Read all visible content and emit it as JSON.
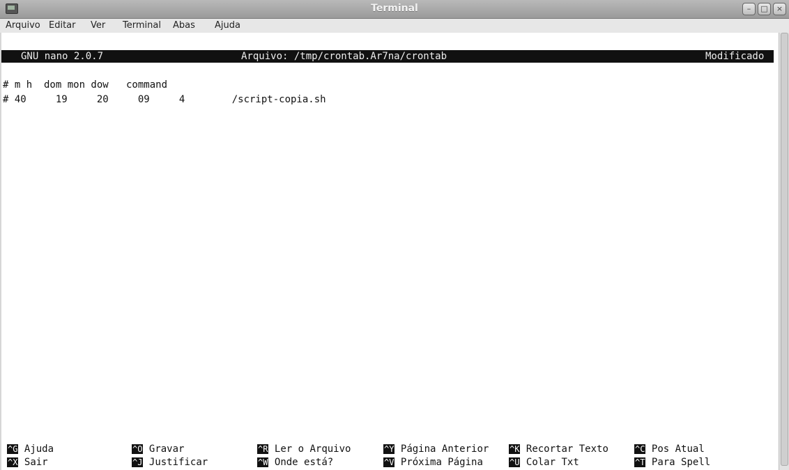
{
  "window": {
    "title": "Terminal",
    "minimize_icon": "minimize-icon",
    "maximize_icon": "maximize-icon",
    "close_icon": "close-icon"
  },
  "menubar": {
    "items": [
      "Arquivo",
      "Editar",
      "Ver",
      "Terminal",
      "Abas",
      "Ajuda"
    ]
  },
  "nano_header": {
    "version": "GNU nano 2.0.7",
    "file": "Arquivo: /tmp/crontab.Ar7na/crontab",
    "status": "Modificado"
  },
  "buffer": {
    "lines": [
      "# m h  dom mon dow   command",
      "# 40     19     20     09     4        /script-copia.sh"
    ]
  },
  "shortcuts": [
    {
      "key": "^G",
      "label": "Ajuda"
    },
    {
      "key": "^O",
      "label": "Gravar"
    },
    {
      "key": "^R",
      "label": "Ler o Arquivo"
    },
    {
      "key": "^Y",
      "label": "Página Anterior"
    },
    {
      "key": "^K",
      "label": "Recortar Texto"
    },
    {
      "key": "^C",
      "label": "Pos Atual"
    },
    {
      "key": "^X",
      "label": "Sair"
    },
    {
      "key": "^J",
      "label": "Justificar"
    },
    {
      "key": "^W",
      "label": "Onde está?"
    },
    {
      "key": "^V",
      "label": "Próxima Página"
    },
    {
      "key": "^U",
      "label": "Colar Txt"
    },
    {
      "key": "^T",
      "label": "Para Spell"
    }
  ]
}
